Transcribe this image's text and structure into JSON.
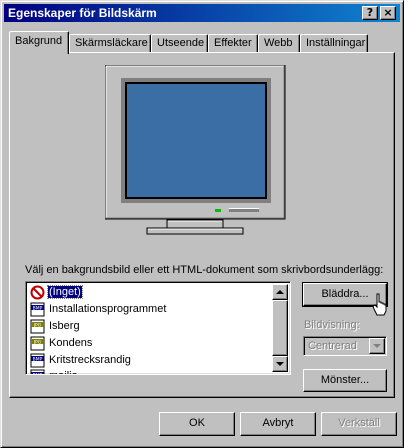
{
  "window": {
    "title": "Egenskaper för Bildskärm",
    "help_button": "?",
    "close_button": "×"
  },
  "tabs": [
    {
      "label": "Bakgrund",
      "active": true
    },
    {
      "label": "Skärmsläckare",
      "active": false
    },
    {
      "label": "Utseende",
      "active": false
    },
    {
      "label": "Effekter",
      "active": false
    },
    {
      "label": "Webb",
      "active": false
    },
    {
      "label": "Inställningar",
      "active": false
    }
  ],
  "background_tab": {
    "instruction": "Välj en bakgrundsbild eller ett HTML-dokument som skrivbordsunderlägg:",
    "wallpapers": [
      {
        "label": "(Inget)",
        "icon": "none-icon",
        "selected": true
      },
      {
        "label": "Installationsprogrammet",
        "icon": "bmp-icon",
        "selected": false
      },
      {
        "label": "Isberg",
        "icon": "jpg-icon",
        "selected": false
      },
      {
        "label": "Kondens",
        "icon": "jpg-icon",
        "selected": false
      },
      {
        "label": "Kritstrecksrandig",
        "icon": "bmp-icon",
        "selected": false
      },
      {
        "label": "mailia",
        "icon": "bmp-icon",
        "selected": false
      }
    ],
    "browse_button": "Bläddra...",
    "display_label": "Bildvisning:",
    "display_value": "Centrerad",
    "pattern_button": "Mönster...",
    "monitor_screen_color": "#3a6ea5"
  },
  "footer": {
    "ok_label": "OK",
    "cancel_label": "Avbryt",
    "apply_label": "Verkställ"
  }
}
